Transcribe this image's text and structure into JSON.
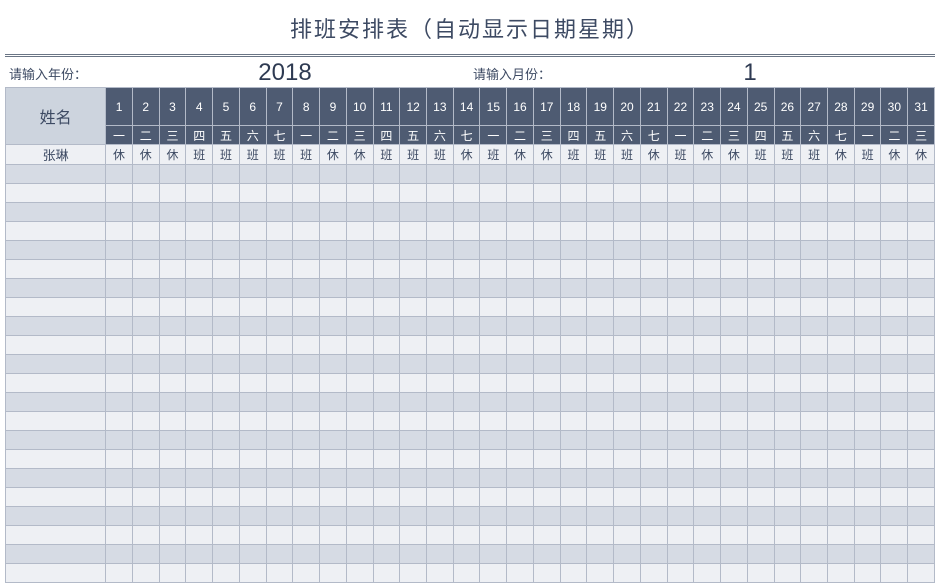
{
  "title": "排班安排表（自动显示日期星期）",
  "inputs": {
    "year_label": "请输入年份：",
    "year_value": "2018",
    "month_label": "请输入月份：",
    "month_value": "1"
  },
  "headers": {
    "name_label": "姓名",
    "days": [
      "1",
      "2",
      "3",
      "4",
      "5",
      "6",
      "7",
      "8",
      "9",
      "10",
      "11",
      "12",
      "13",
      "14",
      "15",
      "16",
      "17",
      "18",
      "19",
      "20",
      "21",
      "22",
      "23",
      "24",
      "25",
      "26",
      "27",
      "28",
      "29",
      "30",
      "31"
    ],
    "weekdays": [
      "一",
      "二",
      "三",
      "四",
      "五",
      "六",
      "七",
      "一",
      "二",
      "三",
      "四",
      "五",
      "六",
      "七",
      "一",
      "二",
      "三",
      "四",
      "五",
      "六",
      "七",
      "一",
      "二",
      "三",
      "四",
      "五",
      "六",
      "七",
      "一",
      "二",
      "三"
    ]
  },
  "rows": [
    {
      "name": "张琳",
      "cells": [
        "休",
        "休",
        "休",
        "班",
        "班",
        "班",
        "班",
        "班",
        "休",
        "休",
        "班",
        "班",
        "班",
        "休",
        "班",
        "休",
        "休",
        "班",
        "班",
        "班",
        "休",
        "班",
        "休",
        "休",
        "班",
        "班",
        "班",
        "休",
        "班",
        "休",
        "休"
      ]
    },
    {
      "name": "",
      "cells": [
        "",
        "",
        "",
        "",
        "",
        "",
        "",
        "",
        "",
        "",
        "",
        "",
        "",
        "",
        "",
        "",
        "",
        "",
        "",
        "",
        "",
        "",
        "",
        "",
        "",
        "",
        "",
        "",
        "",
        "",
        ""
      ]
    },
    {
      "name": "",
      "cells": [
        "",
        "",
        "",
        "",
        "",
        "",
        "",
        "",
        "",
        "",
        "",
        "",
        "",
        "",
        "",
        "",
        "",
        "",
        "",
        "",
        "",
        "",
        "",
        "",
        "",
        "",
        "",
        "",
        "",
        "",
        ""
      ]
    },
    {
      "name": "",
      "cells": [
        "",
        "",
        "",
        "",
        "",
        "",
        "",
        "",
        "",
        "",
        "",
        "",
        "",
        "",
        "",
        "",
        "",
        "",
        "",
        "",
        "",
        "",
        "",
        "",
        "",
        "",
        "",
        "",
        "",
        "",
        ""
      ]
    },
    {
      "name": "",
      "cells": [
        "",
        "",
        "",
        "",
        "",
        "",
        "",
        "",
        "",
        "",
        "",
        "",
        "",
        "",
        "",
        "",
        "",
        "",
        "",
        "",
        "",
        "",
        "",
        "",
        "",
        "",
        "",
        "",
        "",
        "",
        ""
      ]
    },
    {
      "name": "",
      "cells": [
        "",
        "",
        "",
        "",
        "",
        "",
        "",
        "",
        "",
        "",
        "",
        "",
        "",
        "",
        "",
        "",
        "",
        "",
        "",
        "",
        "",
        "",
        "",
        "",
        "",
        "",
        "",
        "",
        "",
        "",
        ""
      ]
    },
    {
      "name": "",
      "cells": [
        "",
        "",
        "",
        "",
        "",
        "",
        "",
        "",
        "",
        "",
        "",
        "",
        "",
        "",
        "",
        "",
        "",
        "",
        "",
        "",
        "",
        "",
        "",
        "",
        "",
        "",
        "",
        "",
        "",
        "",
        ""
      ]
    },
    {
      "name": "",
      "cells": [
        "",
        "",
        "",
        "",
        "",
        "",
        "",
        "",
        "",
        "",
        "",
        "",
        "",
        "",
        "",
        "",
        "",
        "",
        "",
        "",
        "",
        "",
        "",
        "",
        "",
        "",
        "",
        "",
        "",
        "",
        ""
      ]
    },
    {
      "name": "",
      "cells": [
        "",
        "",
        "",
        "",
        "",
        "",
        "",
        "",
        "",
        "",
        "",
        "",
        "",
        "",
        "",
        "",
        "",
        "",
        "",
        "",
        "",
        "",
        "",
        "",
        "",
        "",
        "",
        "",
        "",
        "",
        ""
      ]
    },
    {
      "name": "",
      "cells": [
        "",
        "",
        "",
        "",
        "",
        "",
        "",
        "",
        "",
        "",
        "",
        "",
        "",
        "",
        "",
        "",
        "",
        "",
        "",
        "",
        "",
        "",
        "",
        "",
        "",
        "",
        "",
        "",
        "",
        "",
        ""
      ]
    },
    {
      "name": "",
      "cells": [
        "",
        "",
        "",
        "",
        "",
        "",
        "",
        "",
        "",
        "",
        "",
        "",
        "",
        "",
        "",
        "",
        "",
        "",
        "",
        "",
        "",
        "",
        "",
        "",
        "",
        "",
        "",
        "",
        "",
        "",
        ""
      ]
    },
    {
      "name": "",
      "cells": [
        "",
        "",
        "",
        "",
        "",
        "",
        "",
        "",
        "",
        "",
        "",
        "",
        "",
        "",
        "",
        "",
        "",
        "",
        "",
        "",
        "",
        "",
        "",
        "",
        "",
        "",
        "",
        "",
        "",
        "",
        ""
      ]
    },
    {
      "name": "",
      "cells": [
        "",
        "",
        "",
        "",
        "",
        "",
        "",
        "",
        "",
        "",
        "",
        "",
        "",
        "",
        "",
        "",
        "",
        "",
        "",
        "",
        "",
        "",
        "",
        "",
        "",
        "",
        "",
        "",
        "",
        "",
        ""
      ]
    },
    {
      "name": "",
      "cells": [
        "",
        "",
        "",
        "",
        "",
        "",
        "",
        "",
        "",
        "",
        "",
        "",
        "",
        "",
        "",
        "",
        "",
        "",
        "",
        "",
        "",
        "",
        "",
        "",
        "",
        "",
        "",
        "",
        "",
        "",
        ""
      ]
    },
    {
      "name": "",
      "cells": [
        "",
        "",
        "",
        "",
        "",
        "",
        "",
        "",
        "",
        "",
        "",
        "",
        "",
        "",
        "",
        "",
        "",
        "",
        "",
        "",
        "",
        "",
        "",
        "",
        "",
        "",
        "",
        "",
        "",
        "",
        ""
      ]
    },
    {
      "name": "",
      "cells": [
        "",
        "",
        "",
        "",
        "",
        "",
        "",
        "",
        "",
        "",
        "",
        "",
        "",
        "",
        "",
        "",
        "",
        "",
        "",
        "",
        "",
        "",
        "",
        "",
        "",
        "",
        "",
        "",
        "",
        "",
        ""
      ]
    },
    {
      "name": "",
      "cells": [
        "",
        "",
        "",
        "",
        "",
        "",
        "",
        "",
        "",
        "",
        "",
        "",
        "",
        "",
        "",
        "",
        "",
        "",
        "",
        "",
        "",
        "",
        "",
        "",
        "",
        "",
        "",
        "",
        "",
        "",
        ""
      ]
    },
    {
      "name": "",
      "cells": [
        "",
        "",
        "",
        "",
        "",
        "",
        "",
        "",
        "",
        "",
        "",
        "",
        "",
        "",
        "",
        "",
        "",
        "",
        "",
        "",
        "",
        "",
        "",
        "",
        "",
        "",
        "",
        "",
        "",
        "",
        ""
      ]
    },
    {
      "name": "",
      "cells": [
        "",
        "",
        "",
        "",
        "",
        "",
        "",
        "",
        "",
        "",
        "",
        "",
        "",
        "",
        "",
        "",
        "",
        "",
        "",
        "",
        "",
        "",
        "",
        "",
        "",
        "",
        "",
        "",
        "",
        "",
        ""
      ]
    },
    {
      "name": "",
      "cells": [
        "",
        "",
        "",
        "",
        "",
        "",
        "",
        "",
        "",
        "",
        "",
        "",
        "",
        "",
        "",
        "",
        "",
        "",
        "",
        "",
        "",
        "",
        "",
        "",
        "",
        "",
        "",
        "",
        "",
        "",
        ""
      ]
    },
    {
      "name": "",
      "cells": [
        "",
        "",
        "",
        "",
        "",
        "",
        "",
        "",
        "",
        "",
        "",
        "",
        "",
        "",
        "",
        "",
        "",
        "",
        "",
        "",
        "",
        "",
        "",
        "",
        "",
        "",
        "",
        "",
        "",
        "",
        ""
      ]
    },
    {
      "name": "",
      "cells": [
        "",
        "",
        "",
        "",
        "",
        "",
        "",
        "",
        "",
        "",
        "",
        "",
        "",
        "",
        "",
        "",
        "",
        "",
        "",
        "",
        "",
        "",
        "",
        "",
        "",
        "",
        "",
        "",
        "",
        "",
        ""
      ]
    },
    {
      "name": "",
      "cells": [
        "",
        "",
        "",
        "",
        "",
        "",
        "",
        "",
        "",
        "",
        "",
        "",
        "",
        "",
        "",
        "",
        "",
        "",
        "",
        "",
        "",
        "",
        "",
        "",
        "",
        "",
        "",
        "",
        "",
        "",
        ""
      ]
    }
  ]
}
